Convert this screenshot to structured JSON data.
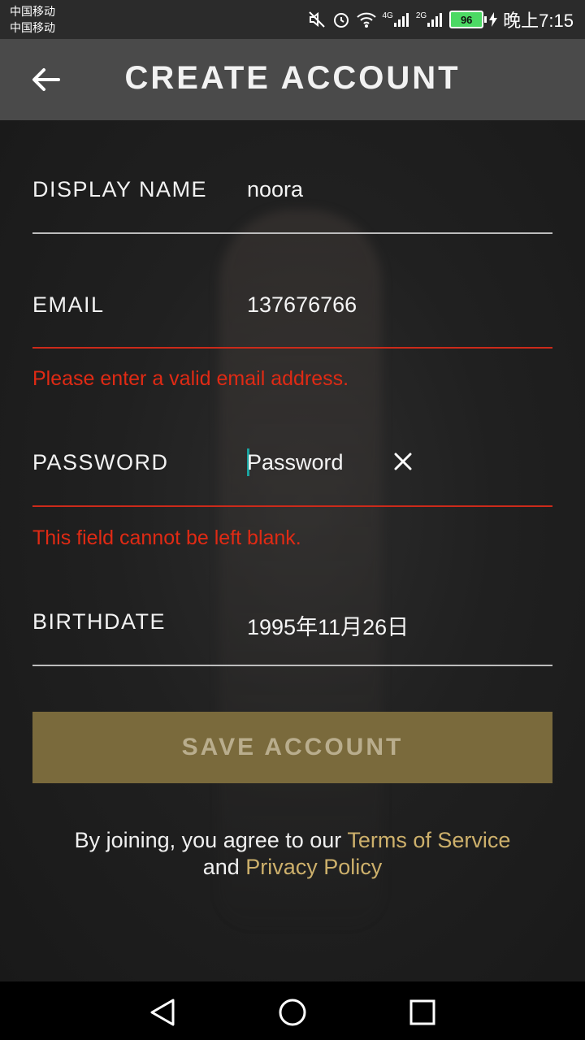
{
  "status_bar": {
    "carrier_1": "中国移动",
    "carrier_2": "中国移动",
    "network_4g": "4G",
    "network_2g": "2G",
    "battery_level": "96",
    "time": "晚上7:15"
  },
  "header": {
    "title": "CREATE ACCOUNT"
  },
  "form": {
    "display_name": {
      "label": "DISPLAY NAME",
      "value": "noora"
    },
    "email": {
      "label": "EMAIL",
      "value": "137676766",
      "error": "Please enter a valid email address."
    },
    "password": {
      "label": "PASSWORD",
      "placeholder": "Password",
      "error": "This field cannot be left blank."
    },
    "birthdate": {
      "label": "BIRTHDATE",
      "value": "1995年11月26日"
    }
  },
  "save_button": {
    "label": "SAVE ACCOUNT"
  },
  "terms": {
    "prefix": "By joining, you agree to our ",
    "terms_link": "Terms of Service",
    "and": "and ",
    "privacy_link": "Privacy Policy"
  },
  "colors": {
    "accent_gold": "#cdb06b",
    "button_bg": "#7a6a3c",
    "error_red": "#e02a14",
    "cursor_teal": "#1aa3a0"
  },
  "icons": {
    "back": "arrow-left-icon",
    "clear": "close-icon",
    "nav_back": "triangle-back-icon",
    "nav_home": "circle-home-icon",
    "nav_recents": "square-recents-icon"
  }
}
